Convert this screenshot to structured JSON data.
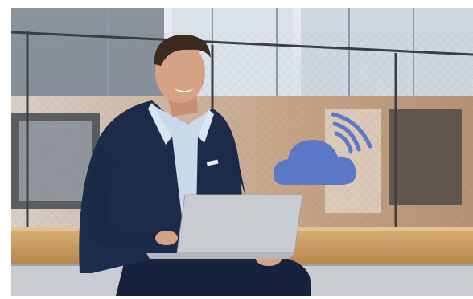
{
  "image": {
    "alt": "",
    "colors": {
      "background": "#ffffff",
      "building_glass": "#c9d3dc",
      "wall_light": "#d6d9dc",
      "wall_brick": "#c9a27e",
      "ledge_wood": "#c99a5c",
      "jacket": "#1c2b4a",
      "shirt": "#c9d9ea",
      "laptop": "#c8cbd0",
      "cloud_icon": "#5b79c6",
      "skin": "#d6a285",
      "hair": "#3b2a1e"
    },
    "icons": [
      "cloud-wifi-icon"
    ]
  }
}
